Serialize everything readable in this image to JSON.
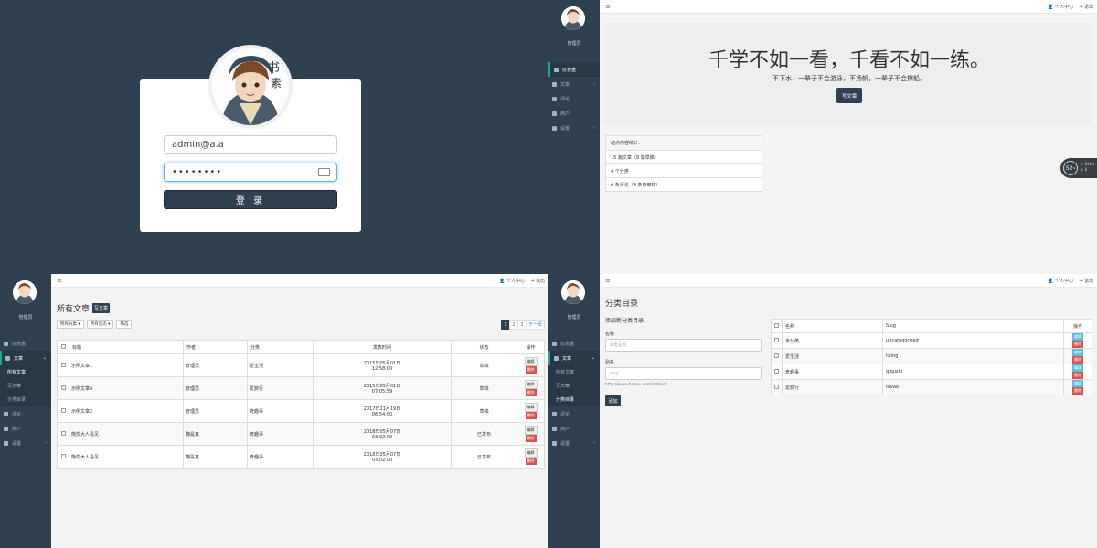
{
  "login": {
    "email_value": "admin@a.a",
    "password_value": "••••••••",
    "submit_label": "登 录"
  },
  "sidebar": {
    "user_name": "管理员",
    "items": [
      {
        "label": "仪表盘",
        "icon": "home-icon"
      },
      {
        "label": "文章",
        "icon": "pin-icon"
      },
      {
        "label": "评论",
        "icon": "comment-icon"
      },
      {
        "label": "用户",
        "icon": "users-icon"
      },
      {
        "label": "设置",
        "icon": "cogs-icon"
      }
    ],
    "sub_items": [
      "所有文章",
      "写文章",
      "分类目录"
    ]
  },
  "topbar": {
    "profile_label": "个人中心",
    "logout_label": "退出"
  },
  "dashboard": {
    "jumbo_title": "千学不如一看，千看不如一练。",
    "jumbo_subtitle": "不下水，一辈子不会游泳，不扬帆，一辈子不会撑船。",
    "write_button": "写文章",
    "stats_header": "站点内容统计：",
    "stats": [
      "15 篇文章（8 篇草稿）",
      "4 个分类",
      "6 条评论（4 条待审核）"
    ],
    "speed_value": "52",
    "speed_unit": "%",
    "speed_up": "↑ 24k/s",
    "speed_down": "↓ 0"
  },
  "posts": {
    "title": "所有文章",
    "write_tag": "写文章",
    "filter_category": "所有分类",
    "filter_status": "所有状态",
    "filter_button": "筛选",
    "pages": [
      "1",
      "2",
      "3",
      "下一页"
    ],
    "columns": [
      "标题",
      "作者",
      "分类",
      "发表时间",
      "状态",
      "操作"
    ],
    "edit_label": "编辑",
    "delete_label": "删除",
    "rows": [
      {
        "title": "示例文章1",
        "author": "管理员",
        "category": "爱生活",
        "date": "2015年05月01日",
        "time": "12:58:00",
        "status": "草稿"
      },
      {
        "title": "示例文章4",
        "author": "管理员",
        "category": "爱旅行",
        "date": "2015年05月01日",
        "time": "07:05:59",
        "status": "草稿"
      },
      {
        "title": "示例文章2",
        "author": "管理员",
        "category": "奇趣事",
        "date": "2017年11月19日",
        "time": "08:54:00",
        "status": "草稿"
      },
      {
        "title": "熊优大人看见",
        "author": "魏是真",
        "category": "奇趣事",
        "date": "2018年05月07日",
        "time": "03:02:00",
        "status": "已发布"
      },
      {
        "title": "熊优大人看见",
        "author": "魏是真",
        "category": "奇趣事",
        "date": "2018年05月07日",
        "time": "03:02:00",
        "status": "已发布"
      }
    ]
  },
  "categories": {
    "title": "分类目录",
    "add_title": "添加新分类目录",
    "name_label": "名称",
    "name_placeholder": "分类名称",
    "slug_label": "别名",
    "slug_placeholder": "slug",
    "slug_hint": "http://www.baixiu.com/admin/",
    "add_button": "添加",
    "columns": [
      "名称",
      "Slug",
      "操作"
    ],
    "edit_label": "编辑",
    "delete_label": "删除",
    "rows": [
      {
        "name": "未分类",
        "slug": "uncategorized"
      },
      {
        "name": "爱生活",
        "slug": "living"
      },
      {
        "name": "奇趣事",
        "slug": "qiqushi"
      },
      {
        "name": "爱旅行",
        "slug": "travel"
      }
    ]
  }
}
